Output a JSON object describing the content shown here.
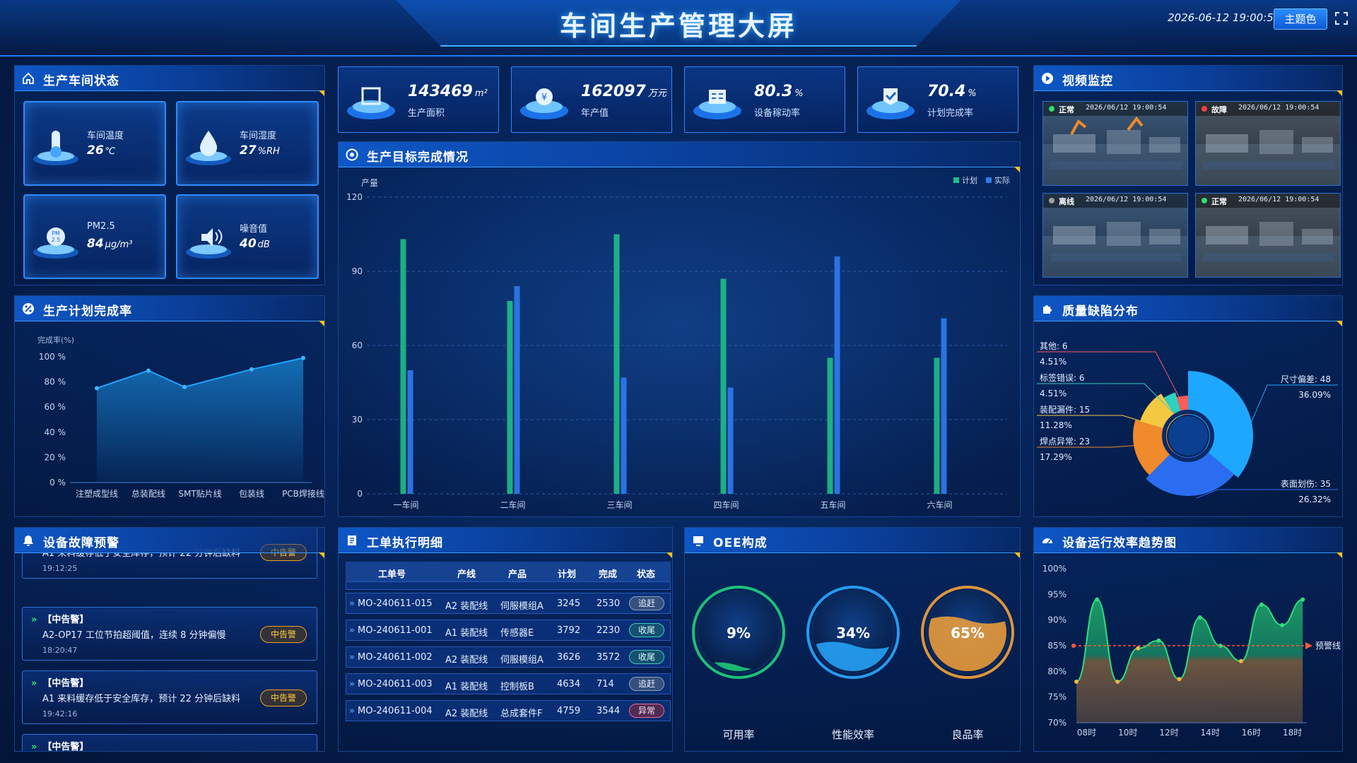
{
  "header": {
    "title": "车间生产管理大屏",
    "datetime": "2026-06-12 19:00:54",
    "theme_button": "主题色",
    "fullscreen_icon": "fullscreen-icon"
  },
  "workshop_status": {
    "title": "生产车间状态",
    "tiles": [
      {
        "label": "车间温度",
        "value": "26",
        "unit": "℃",
        "icon": "thermometer-icon"
      },
      {
        "label": "车间湿度",
        "value": "27",
        "unit": "%RH",
        "icon": "humidity-drop-icon"
      },
      {
        "label": "PM2.5",
        "value": "84",
        "unit": "μg/m³",
        "icon": "pm25-icon"
      },
      {
        "label": "噪音值",
        "value": "40",
        "unit": "dB",
        "icon": "noise-icon"
      }
    ]
  },
  "kpis": [
    {
      "value": "143469",
      "unit": "m²",
      "label": "生产面积",
      "icon": "area-icon"
    },
    {
      "value": "162097",
      "unit": "万元",
      "label": "年产值",
      "icon": "yuan-icon"
    },
    {
      "value": "80.3",
      "unit": "%",
      "label": "设备稼动率",
      "icon": "equipment-icon"
    },
    {
      "value": "70.4",
      "unit": "%",
      "label": "计划完成率",
      "icon": "check-icon"
    }
  ],
  "plan_rate": {
    "title": "生产计划完成率",
    "chart_data": {
      "type": "area",
      "ylabel": "完成率(%)",
      "yticks": [
        "100 %",
        "80 %",
        "60 %",
        "40 %",
        "20 %",
        "0 %"
      ],
      "ylim": [
        0,
        100
      ],
      "categories": [
        "注塑成型线",
        "总装配线",
        "SMT贴片线",
        "包装线",
        "PCB焊接线"
      ],
      "values": [
        75,
        89,
        76,
        90,
        99
      ],
      "x_positions": [
        0,
        1,
        2,
        3,
        4
      ],
      "points": [
        {
          "x": 0,
          "y": 75
        },
        {
          "x": 1,
          "y": 89
        },
        {
          "x": 1.7,
          "y": 76
        },
        {
          "x": 3,
          "y": 90
        },
        {
          "x": 4,
          "y": 99
        }
      ]
    }
  },
  "target": {
    "title": "生产目标完成情况",
    "chart_data": {
      "type": "bar",
      "ylabel": "产量",
      "ylim": [
        0,
        120
      ],
      "yticks": [
        0,
        30,
        60,
        90,
        120
      ],
      "categories": [
        "一车间",
        "二车间",
        "三车间",
        "四车间",
        "五车间",
        "六车间"
      ],
      "series": [
        {
          "name": "计划",
          "color": "#1fbf86",
          "values": [
            103,
            78,
            105,
            87,
            55,
            55
          ]
        },
        {
          "name": "实际",
          "color": "#2f7bf0",
          "values": [
            50,
            84,
            47,
            43,
            96,
            71
          ]
        }
      ],
      "legend": "top-right"
    }
  },
  "video": {
    "title": "视频监控",
    "feeds": [
      {
        "status": "正常",
        "color": "#2ee06a",
        "time": "2026/06/12 19:00:54"
      },
      {
        "status": "故障",
        "color": "#ff4040",
        "time": "2026/06/12 19:00:54"
      },
      {
        "status": "离线",
        "color": "#a0a0a0",
        "time": "2026/06/12 19:00:54"
      },
      {
        "status": "正常",
        "color": "#2ee06a",
        "time": "2026/06/12 19:00:54"
      }
    ]
  },
  "defects": {
    "title": "质量缺陷分布",
    "chart_data": {
      "type": "pie",
      "slices": [
        {
          "label": "尺寸偏差: 48",
          "pct": "36.09%",
          "value": 48,
          "color": "#1ea7ff"
        },
        {
          "label": "表面划伤: 35",
          "pct": "26.32%",
          "value": 35,
          "color": "#2a6df0"
        },
        {
          "label": "焊点异常: 23",
          "pct": "17.29%",
          "value": 23,
          "color": "#f08a2a"
        },
        {
          "label": "装配漏件: 15",
          "pct": "11.28%",
          "value": 15,
          "color": "#f5c842"
        },
        {
          "label": "标签错误: 6",
          "pct": "4.51%",
          "value": 6,
          "color": "#2fd0c0"
        },
        {
          "label": "其他: 6",
          "pct": "4.51%",
          "value": 6,
          "color": "#ff5a5a"
        }
      ]
    }
  },
  "alerts": {
    "title": "设备故障预警",
    "top_partial": "A1 来料缓存低于安全库存，预计 22 分钟后缺料",
    "top_time": "19:12:25",
    "top_badge": "中告警",
    "items": [
      {
        "level": "【中告警】",
        "msg": "A2-OP17 工位节拍超阈值，连续 8 分钟偏慢",
        "time": "18:20:47",
        "badge": "中告警"
      },
      {
        "level": "【中告警】",
        "msg": "A1 来料缓存低于安全库存，预计 22 分钟后缺料",
        "time": "19:42:16",
        "badge": "中告警"
      }
    ],
    "bottom_partial": "【中告警】"
  },
  "workorders": {
    "title": "工单执行明细",
    "columns": [
      "工单号",
      "产线",
      "产品",
      "计划",
      "完成",
      "状态"
    ],
    "rows": [
      {
        "id": "MO-240611-015",
        "line": "A2 装配线",
        "product": "伺服模组A",
        "plan": "3245",
        "done": "2530",
        "status": "追赶",
        "kind": "chase"
      },
      {
        "id": "MO-240611-001",
        "line": "A1 装配线",
        "product": "传感器E",
        "plan": "3792",
        "done": "2230",
        "status": "收尾",
        "kind": "finish"
      },
      {
        "id": "MO-240611-002",
        "line": "A2 装配线",
        "product": "伺服模组A",
        "plan": "3626",
        "done": "3572",
        "status": "收尾",
        "kind": "finish"
      },
      {
        "id": "MO-240611-003",
        "line": "A1 装配线",
        "product": "控制板B",
        "plan": "4634",
        "done": "714",
        "status": "追赶",
        "kind": "chase"
      },
      {
        "id": "MO-240611-004",
        "line": "A2 装配线",
        "product": "总成套件F",
        "plan": "4759",
        "done": "3544",
        "status": "异常",
        "kind": "abnormal"
      }
    ]
  },
  "oee": {
    "title": "OEE构成",
    "gauges": [
      {
        "value": "9%",
        "label": "可用率",
        "color": "#1fd17a"
      },
      {
        "value": "34%",
        "label": "性能效率",
        "color": "#28a8ff"
      },
      {
        "value": "65%",
        "label": "良品率",
        "color": "#f4a23a"
      }
    ]
  },
  "efficiency": {
    "title": "设备运行效率趋势图",
    "chart_data": {
      "type": "line",
      "yticks": [
        "100%",
        "95%",
        "90%",
        "85%",
        "80%",
        "75%",
        "70%"
      ],
      "ylim": [
        70,
        100
      ],
      "xticks": [
        "08时",
        "10时",
        "12时",
        "14时",
        "16时",
        "18时"
      ],
      "warning_label": "预警线",
      "warning_value": 85,
      "x": [
        7.5,
        8.5,
        9.5,
        10.5,
        11.5,
        12.5,
        13.5,
        14.5,
        15.5,
        16.5,
        17.5,
        18.5
      ],
      "values": [
        78,
        94,
        78,
        84.5,
        86,
        78.5,
        90.5,
        85,
        82,
        93,
        89,
        94
      ]
    }
  }
}
